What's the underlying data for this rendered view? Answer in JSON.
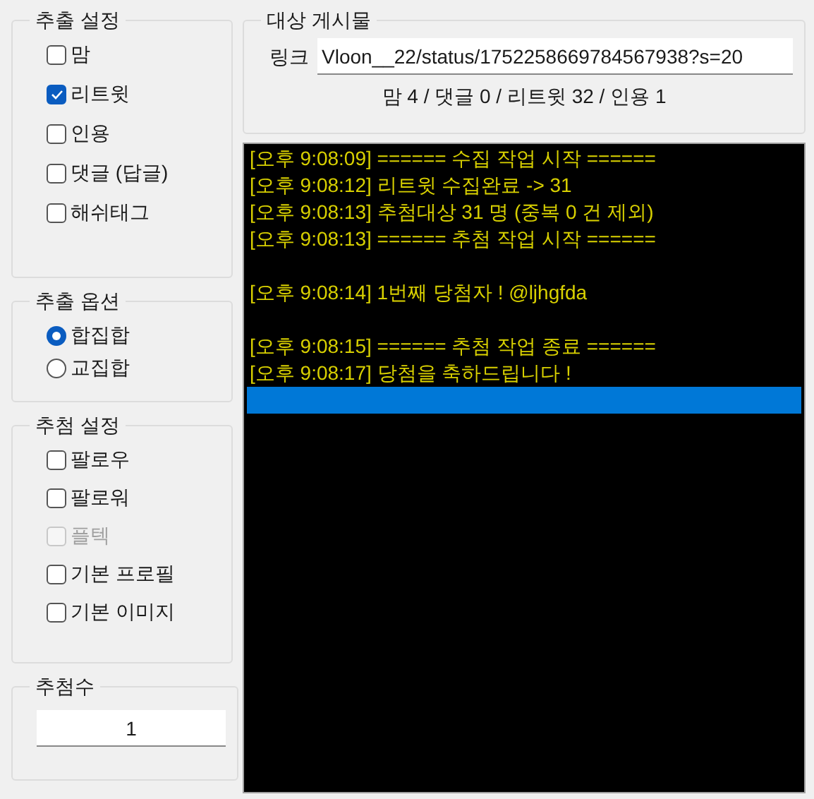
{
  "extract_settings": {
    "title": "추출 설정",
    "options": [
      {
        "label": "맘",
        "checked": false,
        "disabled": false
      },
      {
        "label": "리트윗",
        "checked": true,
        "disabled": false
      },
      {
        "label": "인용",
        "checked": false,
        "disabled": false
      },
      {
        "label": "댓글 (답글)",
        "checked": false,
        "disabled": false
      },
      {
        "label": "해쉬태그",
        "checked": false,
        "disabled": false
      }
    ]
  },
  "extract_options": {
    "title": "추출 옵션",
    "options": [
      {
        "label": "합집합",
        "selected": true
      },
      {
        "label": "교집합",
        "selected": false
      }
    ]
  },
  "draw_settings": {
    "title": "추첨 설정",
    "options": [
      {
        "label": "팔로우",
        "checked": false,
        "disabled": false
      },
      {
        "label": "팔로워",
        "checked": false,
        "disabled": false
      },
      {
        "label": "플텍",
        "checked": false,
        "disabled": true
      },
      {
        "label": "기본 프로필",
        "checked": false,
        "disabled": false
      },
      {
        "label": "기본 이미지",
        "checked": false,
        "disabled": false
      }
    ]
  },
  "winner_count": {
    "title": "추첨수",
    "value": "1"
  },
  "target_post": {
    "title": "대상 게시물",
    "link_label": "링크",
    "link_value": "Vloon__22/status/1752258669784567938?s=20",
    "summary": "맘 4 / 댓글 0 / 리트윗 32 / 인용 1"
  },
  "log": [
    {
      "kind": "line",
      "text": "[오후 9:08:09] ====== 수집 작업 시작 ======",
      "selected": false
    },
    {
      "kind": "line",
      "text": "[오후 9:08:12] 리트윗 수집완료 -> 31",
      "selected": false
    },
    {
      "kind": "line",
      "text": "[오후 9:08:13] 추첨대상 31 명 (중복 0 건 제외)",
      "selected": false
    },
    {
      "kind": "line",
      "text": "[오후 9:08:13] ====== 추첨 작업 시작 ======",
      "selected": false
    },
    {
      "kind": "spacer"
    },
    {
      "kind": "line",
      "text": "[오후 9:08:14] 1번째 당첨자 ! @ljhgfda",
      "selected": false
    },
    {
      "kind": "spacer"
    },
    {
      "kind": "line",
      "text": "[오후 9:08:15] ====== 추첨 작업 종료 ======",
      "selected": false
    },
    {
      "kind": "line",
      "text": "[오후 9:08:17] 당첨을 축하드립니다 !",
      "selected": false
    },
    {
      "kind": "line",
      "selected": true
    }
  ]
}
